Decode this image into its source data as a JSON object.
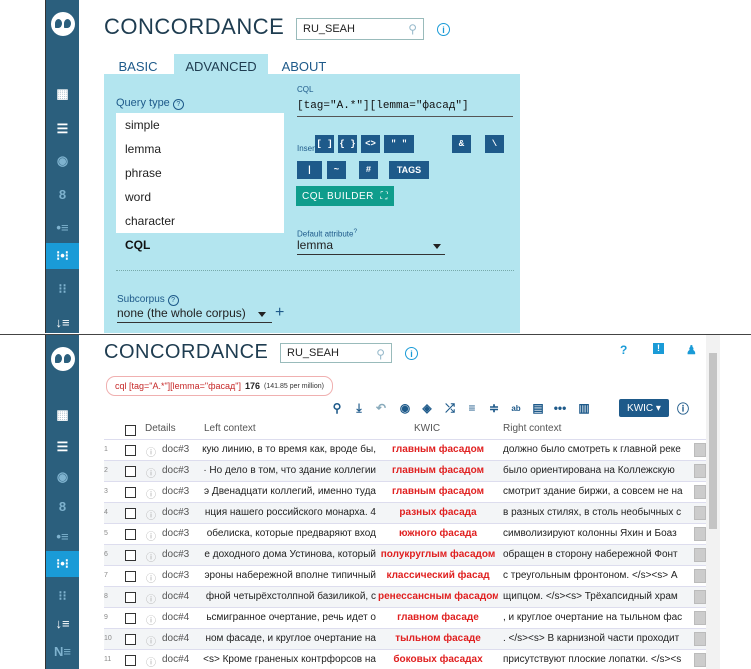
{
  "top": {
    "title": "CONCORDANCE",
    "corpus": "RU_SEAH",
    "tabs": [
      "BASIC",
      "ADVANCED",
      "ABOUT"
    ],
    "query_type_label": "Query type",
    "query_types": [
      "simple",
      "lemma",
      "phrase",
      "word",
      "character",
      "CQL"
    ],
    "selected_query_type": "CQL",
    "cql_label": "CQL",
    "cql_value": "[tag=\"A.*\"][lemma=\"фасад\"]",
    "insert_label": "Insert",
    "insert_row1": [
      "[ ]",
      "{ }",
      "<>",
      "\" \"",
      "&",
      "\\"
    ],
    "insert_row2": [
      "|",
      "~",
      "#",
      "TAGS"
    ],
    "cql_builder": "CQL BUILDER",
    "default_attr_label": "Default attribute",
    "default_attr_value": "lemma",
    "subcorpus_label": "Subcorpus",
    "subcorpus_value": "none (the whole corpus)"
  },
  "bottom": {
    "title": "CONCORDANCE",
    "corpus": "RU_SEAH",
    "query_chip": "cql [tag=\"A.*\"][lemma=\"фасад\"]",
    "hits": "176",
    "per_million": "(141.85 per million)",
    "view_mode": "KWIC",
    "headers": {
      "details": "Details",
      "left": "Left context",
      "kwic": "KWIC",
      "right": "Right context"
    },
    "rows": [
      {
        "n": "1",
        "doc": "doc#3",
        "left": "кую линию, в то время как, вроде бы,",
        "kwic": "главным фасадом",
        "right": "должно было смотреть к главной реке"
      },
      {
        "n": "2",
        "doc": "doc#3",
        "left": "· Но дело в том, что здание коллегии",
        "kwic": "главным фасадом",
        "right": "было ориентирована на Коллежскую"
      },
      {
        "n": "3",
        "doc": "doc#3",
        "left": "э Двенадцати коллегий, именно туда",
        "kwic": "главным фасадом",
        "right": "смотрит здание биржи, а совсем не на"
      },
      {
        "n": "4",
        "doc": "doc#3",
        "left": "нция нашего российского монарха. 4",
        "kwic": "разных фасада",
        "right": "в разных стилях, в столь необычных с"
      },
      {
        "n": "5",
        "doc": "doc#3",
        "left": "обелиска, которые предваряют вход",
        "kwic": "южного фасада",
        "right": "символизируют колонны Яхин и Боаз"
      },
      {
        "n": "6",
        "doc": "doc#3",
        "left": "е доходного дома Устинова, который",
        "kwic": "полукруглым фасадом",
        "right": "обращен в сторону набережной Фонт"
      },
      {
        "n": "7",
        "doc": "doc#3",
        "left": "эроны набережной вполне типичный",
        "kwic": "классический фасад",
        "right": "с треугольным фронтоном. </s><s> А"
      },
      {
        "n": "8",
        "doc": "doc#4",
        "left": "фной четырёхстолпной базиликой, с",
        "kwic": "ренессансным фасадом",
        "right": "щипцом. </s><s> Трёхапсидный храм"
      },
      {
        "n": "9",
        "doc": "doc#4",
        "left": "ьсмигранное очертание, речь идет о",
        "kwic": "главном фасаде",
        "right": ", и круглое очертание на тыльном фас"
      },
      {
        "n": "10",
        "doc": "doc#4",
        "left": "ном фасаде, и круглое очертание на",
        "kwic": "тыльном фасаде",
        "right": ". </s><s> В карнизной части проходит"
      },
      {
        "n": "11",
        "doc": "doc#4",
        "left": "<s> Кроме граненых контрфорсов на",
        "kwic": "боковых фасадах",
        "right": "присутствуют плоские лопатки. </s><s"
      }
    ]
  },
  "colors": {
    "sidebar": "#2b5f7d",
    "sidebar_active": "#1a9bd7",
    "panel": "#b3e5ef",
    "primary_button": "#1e5a8a",
    "builder_button": "#0f9d8c",
    "kwic_text": "#e02020"
  }
}
